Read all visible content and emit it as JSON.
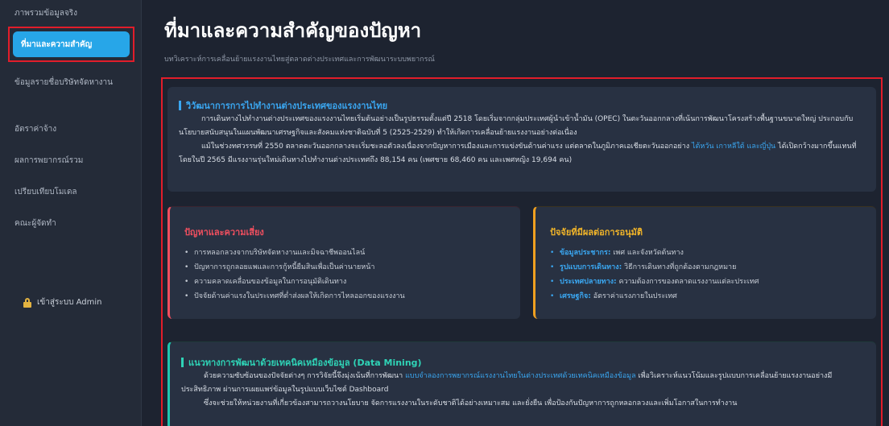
{
  "sidebar": {
    "items": [
      {
        "label": "ภาพรวมข้อมูลจริง"
      },
      {
        "label": "ที่มาและความสำคัญ"
      },
      {
        "label": "ข้อมูลรายชื่อบริษัทจัดหางาน"
      },
      {
        "label": "อัตราค่าจ้าง"
      },
      {
        "label": "ผลการพยากรณ์รวม"
      },
      {
        "label": "เปรียบเทียบโมเดล"
      },
      {
        "label": "คณะผู้จัดทำ"
      }
    ],
    "admin_label": "เข้าสู่ระบบ Admin",
    "admin_icon": "lock-icon"
  },
  "header": {
    "title": "ที่มาและความสำคัญของปัญหา",
    "subtitle": "บทวิเคราะห์การเคลื่อนย้ายแรงงานไทยสู่ตลาดต่างประเทศและการพัฒนาระบบพยากรณ์"
  },
  "card1": {
    "title": "วิวัฒนาการการไปทำงานต่างประเทศของแรงงานไทย",
    "p1": "การเดินทางไปทำงานต่างประเทศของแรงงานไทยเริ่มต้นอย่างเป็นรูปธรรมตั้งแต่ปี 2518 โดยเริ่มจากกลุ่มประเทศผู้นำเข้าน้ำมัน (OPEC) ในตะวันออกกลางที่เน้นการพัฒนาโครงสร้างพื้นฐานขนาดใหญ่ ประกอบกับนโยบายสนับสนุนในแผนพัฒนาเศรษฐกิจและสังคมแห่งชาติฉบับที่ 5 (2525-2529) ทำให้เกิดการเคลื่อนย้ายแรงงานอย่างต่อเนื่อง",
    "p2_a": "แม้ในช่วงทศวรรษที่ 2550 ตลาดตะวันออกกลางจะเริ่มชะลอตัวลงเนื่องจากปัญหาการเมืองและการแข่งขันด้านค่าแรง แต่ตลาดในภูมิภาคเอเชียตะวันออกอย่าง",
    "p2_hl": "ไต้หวัน เกาหลีใต้ และญี่ปุ่น",
    "p2_b": "ได้เปิดกว้างมากขึ้นแทนที่ โดยในปี 2565 มีแรงงานรุ่นใหม่เดินทางไปทำงานต่างประเทศถึง 88,154 คน (เพศชาย 68,460 คน และเพศหญิง 19,694 คน)"
  },
  "card2": {
    "title": "ปัญหาและความเสี่ยง",
    "items": [
      "การหลอกลวงจากบริษัทจัดหางานและมิจฉาชีพออนไลน์",
      "ปัญหาการถูกลอยแพและการกู้หนี้ยืมสินเพื่อเป็นค่านายหน้า",
      "ความคลาดเคลื่อนของข้อมูลในการอนุมัติเดินทาง",
      "ปัจจัยด้านค่าแรงในประเทศที่ต่ำส่งผลให้เกิดการไหลออกของแรงงาน"
    ]
  },
  "card3": {
    "title": "ปัจจัยที่มีผลต่อการอนุมัติ",
    "items": [
      {
        "key": "ข้อมูลประชากร:",
        "text": "เพศ และจังหวัดต้นทาง"
      },
      {
        "key": "รูปแบบการเดินทาง:",
        "text": "วิธีการเดินทางที่ถูกต้องตามกฎหมาย"
      },
      {
        "key": "ประเทศปลายทาง:",
        "text": "ความต้องการของตลาดแรงงานแต่ละประเทศ"
      },
      {
        "key": "เศรษฐกิจ:",
        "text": "อัตราค่าแรงภายในประเทศ"
      }
    ]
  },
  "card4": {
    "title": "แนวทางการพัฒนาด้วยเทคนิคเหมืองข้อมูล (Data Mining)",
    "p1_a": "ด้วยความซับซ้อนของปัจจัยต่างๆ การวิจัยนี้จึงมุ่งเน้นที่การพัฒนา",
    "p1_hl": "แบบจำลองการพยากรณ์แรงงานไทยในต่างประเทศด้วยเทคนิคเหมืองข้อมูล",
    "p1_b": "เพื่อวิเคราะห์แนวโน้มและรูปแบบการเคลื่อนย้ายแรงงานอย่างมีประสิทธิภาพ ผ่านการเผยแพร่ข้อมูลในรูปแบบเว็บไซต์ Dashboard",
    "p2": "ซึ่งจะช่วยให้หน่วยงานที่เกี่ยวข้องสามารถวางนโยบาย จัดการแรงงานในระดับชาติได้อย่างเหมาะสม และยั่งยืน เพื่อป้องกันปัญหาการถูกหลอกลวงและเพิ่มโอกาสในการทำงาน"
  },
  "colors": {
    "accent": "#27a6e8",
    "highlight_border": "#e11d2a",
    "risk": "#ef4f5f",
    "factor": "#f0b429",
    "datamining": "#2fd3b6"
  }
}
